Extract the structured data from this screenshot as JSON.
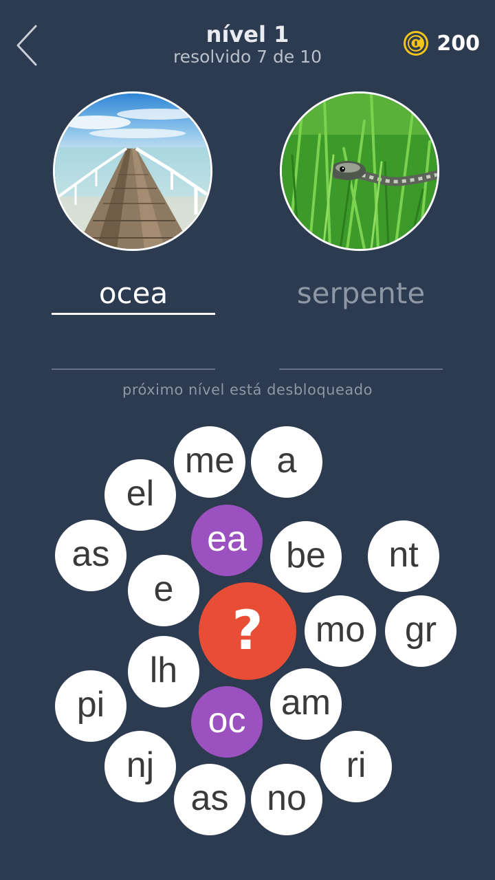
{
  "header": {
    "title": "nível 1",
    "subtitle": "resolvido 7 de 10",
    "coins": "200"
  },
  "clues": [
    {
      "image": "pier-ocean-photo",
      "answer": "ocea"
    },
    {
      "image": "snake-grass-photo",
      "answer": "serpente"
    }
  ],
  "hint": "próximo nível está desbloqueado",
  "tiles": [
    "me",
    "a",
    "el",
    "ea",
    "as",
    "be",
    "nt",
    "e",
    "mo",
    "gr",
    "lh",
    "pi",
    "am",
    "oc",
    "nj",
    "ri",
    "as",
    "no"
  ],
  "selected_tiles": [
    "ea",
    "oc"
  ],
  "help_label": "?",
  "colors": {
    "background": "#2d3b50",
    "tile": "#ffffff",
    "tile_selected": "#9b51c0",
    "help_button": "#e84d35",
    "coin": "#f5c518"
  }
}
